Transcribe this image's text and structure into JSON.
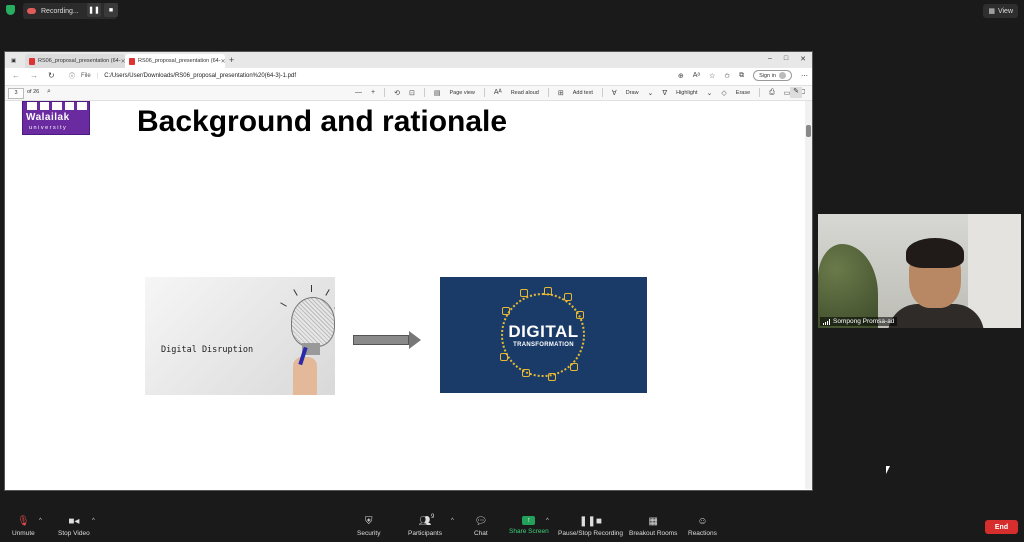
{
  "zoom_top": {
    "recording_label": "Recording...",
    "view_label": "View"
  },
  "browser": {
    "tabs": [
      {
        "label": "RS06_proposal_presentation (64-"
      },
      {
        "label": "RS06_proposal_presentation (64-"
      }
    ],
    "new_tab": "+",
    "window_controls": [
      "–",
      "□",
      "✕"
    ],
    "address": {
      "file_label": "File",
      "url": "C:/Users/User/Downloads/RS06_proposal_presentation%20(64-3)-1.pdf",
      "signin_label": "Sign in"
    }
  },
  "pdf_toolbar": {
    "page_number": "3",
    "page_total": "of 26",
    "minus": "—",
    "plus": "+",
    "page_view": "Page view",
    "read_aloud": "Read aloud",
    "add_text": "Add text",
    "draw": "Draw",
    "highlight": "Highlight",
    "erase": "Erase"
  },
  "slide": {
    "logo_text": "Walailak",
    "logo_sub": "university",
    "title": "Background and rationale",
    "left_image_text": "Digital Disruption",
    "right_image_title": "DIGITAL",
    "right_image_sub": "TRANSFORMATION"
  },
  "participant": {
    "name": "Sompong Promsa-ad"
  },
  "bottom_toolbar": {
    "unmute": "Unmute",
    "stop_video": "Stop Video",
    "security": "Security",
    "participants": "Participants",
    "participants_count": "9",
    "chat": "Chat",
    "share_screen": "Share Screen",
    "pause_recording": "Pause/Stop Recording",
    "breakout_rooms": "Breakout Rooms",
    "reactions": "Reactions",
    "end": "End"
  },
  "colors": {
    "recording_red": "#e25b5b",
    "share_green": "#23a15b",
    "end_red": "#d62d2d",
    "logo_purple": "#6a2aa0",
    "digital_blue": "#1a3b68"
  }
}
